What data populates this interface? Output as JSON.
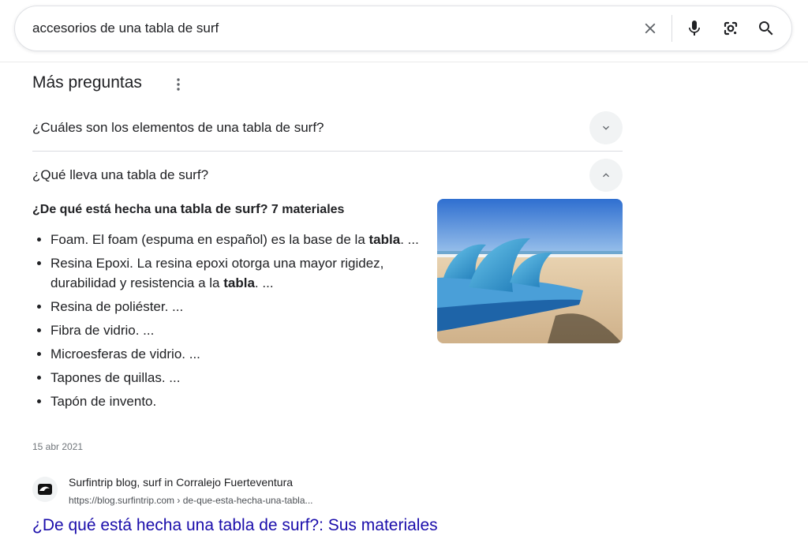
{
  "search": {
    "query": "accesorios de una tabla de surf",
    "icons": [
      "close-icon",
      "microphone-icon",
      "google-lens-icon",
      "search-icon"
    ]
  },
  "people_also_ask": {
    "title": "Más preguntas",
    "menu_icon": "more-vert-icon",
    "questions": [
      {
        "text": "¿Cuáles son los elementos de una tabla de surf?",
        "expanded": false,
        "icon": "chevron-down-icon"
      },
      {
        "text": "¿Qué lleva una tabla de surf?",
        "expanded": true,
        "icon": "chevron-up-icon"
      }
    ],
    "answer": {
      "heading_parts": [
        "¿De qué está hecha una ",
        "tabla de surf",
        "? 7 materiales"
      ],
      "items": [
        [
          "Foam. El foam (espuma en español) es la base de la ",
          "tabla",
          ". ..."
        ],
        [
          "Resina Epoxi. La resina epoxi otorga una mayor rigidez, durabilidad y resistencia a la ",
          "tabla",
          ". ..."
        ],
        [
          "Resina de poliéster. ...",
          "",
          ""
        ],
        [
          "Fibra de vidrio. ...",
          "",
          ""
        ],
        [
          "Microesferas de vidrio. ...",
          "",
          ""
        ],
        [
          "Tapones de quillas. ...",
          "",
          ""
        ],
        [
          "Tapón de invento.",
          "",
          ""
        ]
      ],
      "image_icon": "surfboard-fins-photo",
      "date": "15 abr 2021"
    },
    "source": {
      "name": "Surfintrip blog, surf in Corralejo Fuerteventura",
      "url": "https://blog.surfintrip.com › de-que-esta-hecha-una-tabla...",
      "favicon": "surfintrip-wave-logo",
      "result_title": "¿De qué está hecha una tabla de surf?: Sus materiales"
    }
  },
  "colors": {
    "link": "#1a0dab",
    "text": "#202124",
    "muted": "#70757a",
    "chip": "#f1f3f4"
  }
}
